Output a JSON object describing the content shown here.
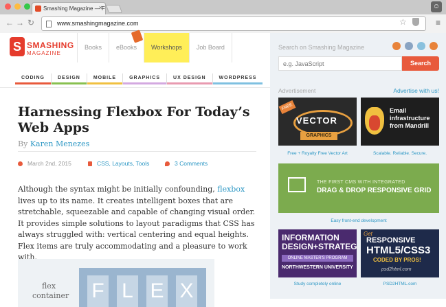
{
  "browser": {
    "tab_title": "Smashing Magazine — Fo",
    "url": "www.smashingmagazine.com"
  },
  "site": {
    "logo_top": "SMASHING",
    "logo_bottom": "MAGAZINE",
    "nav": [
      "Books",
      "eBooks",
      "Workshops",
      "Job Board"
    ],
    "categories": [
      {
        "label": "CODING",
        "color": "#e85a3c"
      },
      {
        "label": "DESIGN",
        "color": "#88c050"
      },
      {
        "label": "MOBILE",
        "color": "#f0c040"
      },
      {
        "label": "GRAPHICS",
        "color": "#d3a9e0"
      },
      {
        "label": "UX DESIGN",
        "color": "#e89ab0"
      },
      {
        "label": "WORDPRESS",
        "color": "#7fc0e0"
      }
    ]
  },
  "article": {
    "title": "Harnessing Flexbox For Today’s Web Apps",
    "by": "By",
    "author": "Karen Menezes",
    "date": "March 2nd, 2015",
    "tags": "CSS, Layouts, Tools",
    "comments": "3 Comments",
    "body_before_link": "Although the syntax might be initially confounding, ",
    "body_link": "flexbox",
    "body_after_link": " lives up to its name. It creates intelligent boxes that are stretchable, squeezable and capable of changing visual order. It provides simple solutions to layout paradigms that CSS has always struggled with: vertical centering and equal heights. Flex items are truly accommodating and a pleasure to work with.",
    "figure_label": "flex container",
    "figure_letters": [
      "F",
      "L",
      "E",
      "X"
    ]
  },
  "sidebar": {
    "search_label": "Search on Smashing Magazine",
    "search_placeholder": "e.g. JavaScript",
    "search_button": "Search",
    "ad_label": "Advertisement",
    "ad_link": "Advertise with us!",
    "ads": [
      {
        "text": "VECTOR",
        "sub": "GRAPHICS",
        "badge": "FREE",
        "caption": "Free + Royalty Free Vector Art"
      },
      {
        "text": "Email infrastructure from Mandrill",
        "caption": "Scalable. Reliable. Secure."
      },
      {
        "text": "THE FIRST CMS WITH INTEGRATED",
        "sub": "DRAG & DROP RESPONSIVE GRID",
        "caption": "Easy front-end development"
      },
      {
        "text": "INFORMATION DESIGN+STRATEGY",
        "sub": "ONLINE MASTER'S PROGRAM",
        "sub2": "NORTHWESTERN UNIVERSITY",
        "caption": "Study completely online"
      },
      {
        "text": "RESPONSIVE",
        "sub": "HTML5/CSS3",
        "sub2": "CODED BY PROS!",
        "top": "Get",
        "site": "psd2html.com",
        "caption": "PSD2HTML.com"
      }
    ]
  }
}
